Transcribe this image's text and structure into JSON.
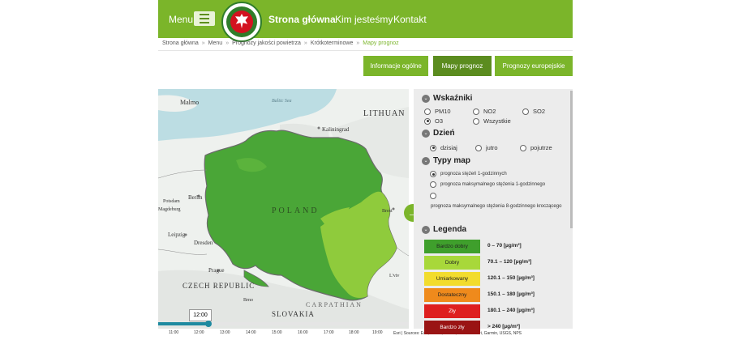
{
  "header": {
    "menu_label": "Menu",
    "nav": [
      "Strona główna",
      "Kim jesteśmy",
      "Kontakt"
    ]
  },
  "breadcrumb": [
    "Strona główna",
    "Menu",
    "Prognozy jakości powietrza",
    "Krótkoterminowe",
    "Mapy prognoz"
  ],
  "tabs": [
    "Informacje ogólne",
    "Mapy prognoz",
    "Prognozy europejskie"
  ],
  "map": {
    "labels": {
      "lithuania": "LITHUAN",
      "poland": "POLAND",
      "czech": "CZECH REPUBLIC",
      "slovakia": "SLOVAKIA",
      "carpathian": "CARPATHIAN",
      "berlin": "Berlin",
      "prague": "Prague",
      "dresden": "Dresden",
      "leipzig": "Leipzig",
      "potsdam": "Potsdam",
      "magdeburg": "Magdeburg",
      "kaliningrad": "Kaliningrad",
      "malmo": "Malmo",
      "baltic": "Baltic Sea",
      "brest": "Brest",
      "lviv": "L'viv",
      "brno": "Brno"
    },
    "time": "12:00",
    "timeline_progress": 0.2,
    "ticks": [
      "11:00",
      "12:00",
      "13:00",
      "14:00",
      "15:00",
      "16:00",
      "17:00",
      "18:00",
      "19:00"
    ],
    "attribution": "Esri | Sources: Esri, USGS, NOAA, Sources: Esri, Garmin, USGS, NPS"
  },
  "panel": {
    "wskazniki": {
      "title": "Wskaźniki",
      "options": [
        "PM10",
        "NO2",
        "SO2",
        "O3",
        "Wszystkie"
      ],
      "selected": "O3"
    },
    "dzien": {
      "title": "Dzień",
      "options": [
        "dzisiaj",
        "jutro",
        "pojutrze"
      ],
      "selected": "dzisiaj"
    },
    "typy": {
      "title": "Typy map",
      "options": [
        "prognoza stężeń 1-godzinnych",
        "prognoza maksymalnego stężenia 1-godzinnego",
        "prognoza maksymalnego stężenia 8-godzinnego kroczącego"
      ],
      "selected": 0
    },
    "legenda": {
      "title": "Legenda",
      "rows": [
        {
          "label": "Bardzo dobry",
          "range": "0 – 70 [µg/m³]",
          "color": "#3f9f2c"
        },
        {
          "label": "Dobry",
          "range": "70.1 – 120 [µg/m³]",
          "color": "#a8d83a"
        },
        {
          "label": "Umiarkowany",
          "range": "120.1 – 150 [µg/m³]",
          "color": "#f2dc2e"
        },
        {
          "label": "Dostateczny",
          "range": "150.1 – 180 [µg/m³]",
          "color": "#ef8a1c"
        },
        {
          "label": "Zły",
          "range": "180.1 – 240 [µg/m³]",
          "color": "#de1f1f"
        },
        {
          "label": "Bardzo zły",
          "range": "> 240 [µg/m³]",
          "color": "#9a1414"
        }
      ]
    }
  }
}
